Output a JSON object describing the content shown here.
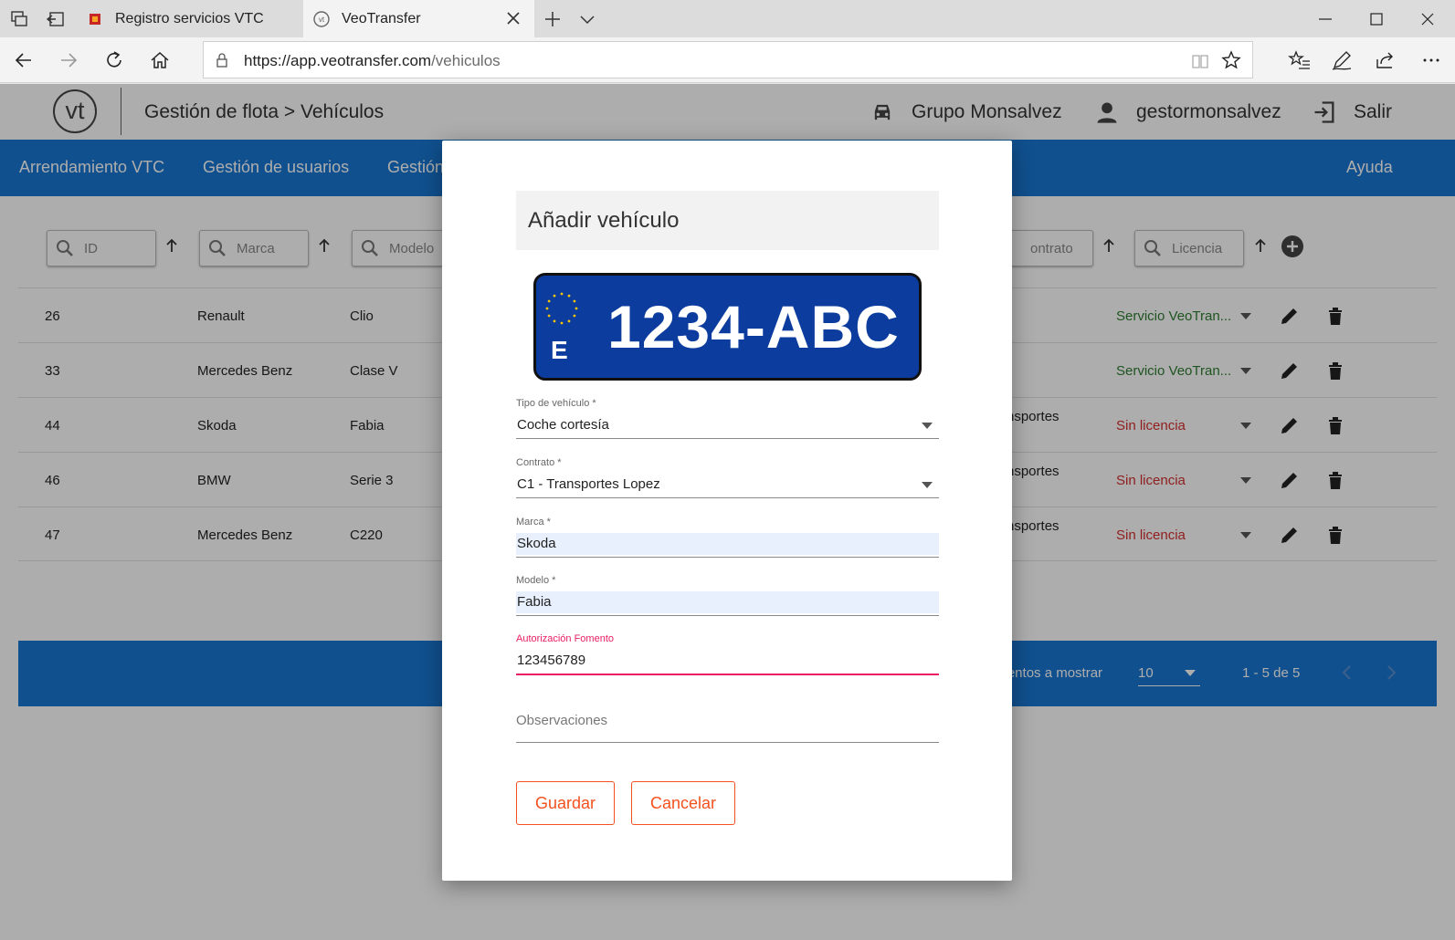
{
  "browser": {
    "tabs": [
      {
        "title": "Registro servicios VTC",
        "active": false
      },
      {
        "title": "VeoTransfer",
        "active": true
      }
    ],
    "url_host": "https://app.veotransfer.com",
    "url_path": "/vehiculos"
  },
  "header": {
    "logo": "vt",
    "breadcrumb": "Gestión de flota > Vehículos",
    "group": "Grupo Monsalvez",
    "user": "gestormonsalvez",
    "logout": "Salir"
  },
  "nav": {
    "items": [
      "Arrendamiento VTC",
      "Gestión de usuarios",
      "Gestión"
    ],
    "help": "Ayuda"
  },
  "filters": {
    "id": "ID",
    "brand": "Marca",
    "model": "Modelo",
    "contract": "ontrato",
    "license": "Licencia"
  },
  "rows": [
    {
      "id": "26",
      "brand": "Renault",
      "model": "Clio",
      "contract": "",
      "license": "Servicio VeoTran...",
      "license_ok": true
    },
    {
      "id": "33",
      "brand": "Mercedes Benz",
      "model": "Clase V",
      "contract": "",
      "license": "Servicio VeoTran...",
      "license_ok": true
    },
    {
      "id": "44",
      "brand": "Skoda",
      "model": "Fabia",
      "contract": "nsportes",
      "license": "Sin licencia",
      "license_ok": false
    },
    {
      "id": "46",
      "brand": "BMW",
      "model": "Serie 3",
      "contract": "nsportes",
      "license": "Sin licencia",
      "license_ok": false
    },
    {
      "id": "47",
      "brand": "Mercedes Benz",
      "model": "C220",
      "contract": "nsportes",
      "license": "Sin licencia",
      "license_ok": false
    }
  ],
  "pagination": {
    "label": "ementos a mostrar",
    "per_page": "10",
    "range": "1 - 5 de 5"
  },
  "modal": {
    "title": "Añadir vehículo",
    "plate_country": "E",
    "plate_number": "1234-ABC",
    "fields": {
      "type_label": "Tipo de vehículo *",
      "type_value": "Coche cortesía",
      "contract_label": "Contrato *",
      "contract_value": "C1 - Transportes Lopez",
      "brand_label": "Marca *",
      "brand_value": "Skoda",
      "model_label": "Modelo *",
      "model_value": "Fabia",
      "auth_label": "Autorización Fomento",
      "auth_value": "123456789",
      "notes_placeholder": "Observaciones"
    },
    "save": "Guardar",
    "cancel": "Cancelar"
  },
  "colors": {
    "primary": "#1976d2",
    "accent": "#f4511e",
    "focus": "#e91e63",
    "license_ok": "#2e7d32",
    "license_no": "#d32f2f",
    "plate": "#0c3c9e"
  }
}
